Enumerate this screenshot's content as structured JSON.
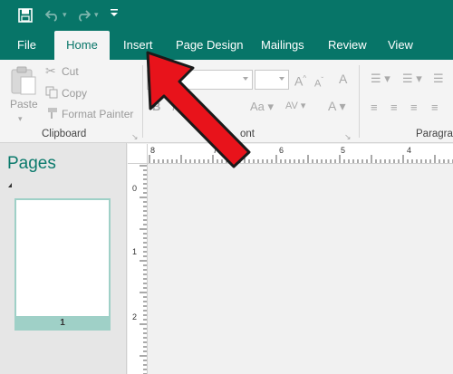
{
  "app": {
    "accent": "#077568"
  },
  "qat": {
    "save_icon": "save-icon",
    "undo_icon": "undo-icon",
    "redo_icon": "redo-icon",
    "customize_icon": "chevron-down-icon"
  },
  "tabs": [
    {
      "label": "File"
    },
    {
      "label": "Home",
      "active": true
    },
    {
      "label": "Insert"
    },
    {
      "label": "Page Design"
    },
    {
      "label": "Mailings"
    },
    {
      "label": "Review"
    },
    {
      "label": "View"
    }
  ],
  "clipboard": {
    "paste": "Paste",
    "cut": "Cut",
    "copy": "Copy",
    "format_painter": "Format Painter",
    "group_label": "Clipboard"
  },
  "font": {
    "group_label_partial": "ont"
  },
  "paragraph": {
    "group_label_partial": "Paragra"
  },
  "pages_pane": {
    "title": "Pages",
    "page_number": "1"
  },
  "ruler": {
    "h_labels": [
      "8",
      "7",
      "6",
      "5",
      "4"
    ],
    "v_labels": [
      "0",
      "1",
      "2"
    ]
  },
  "annotation": {
    "arrow_color": "#e8131b",
    "arrow_target": "Insert"
  }
}
